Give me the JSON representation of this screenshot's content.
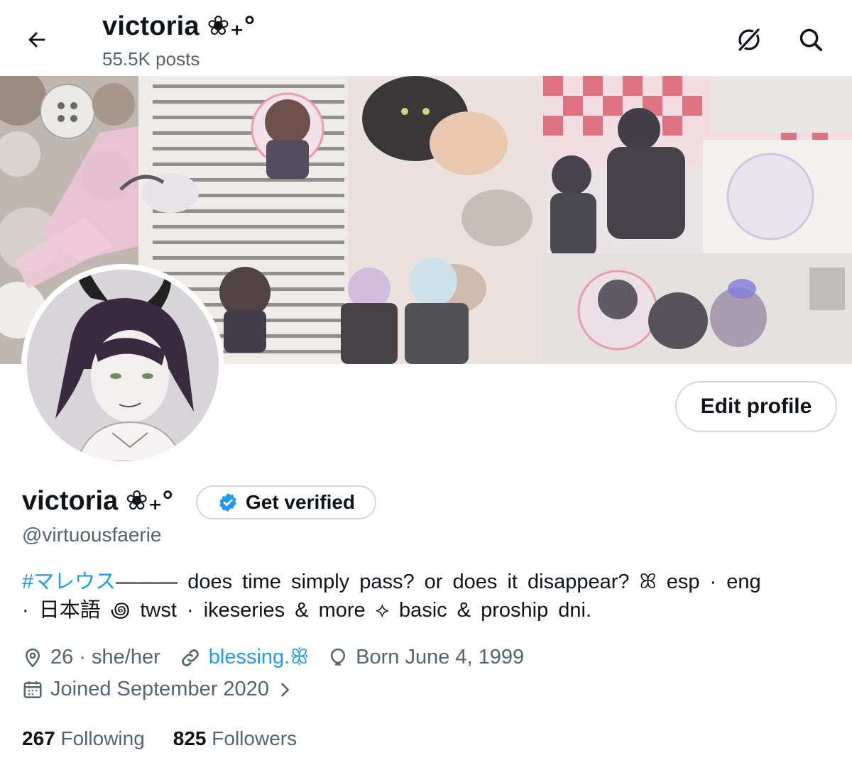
{
  "header": {
    "title": "victoria ❀₊°",
    "posts_count": "55.5K posts"
  },
  "profile": {
    "display_name": "victoria ❀₊°",
    "handle": "@virtuousfaerie",
    "verify_label": "Get verified",
    "edit_label": "Edit profile",
    "bio_hashtag": "#マレウス",
    "bio_line1_rest": "——— does time simply pass? or does it disappear? ꕤ esp · eng",
    "bio_line2": "· 日本語 ꩜ twst · ikeseries & more ⟡ basic & proship dni."
  },
  "meta": {
    "location": "26 · she/her",
    "link": "blessing.ꕥ",
    "birthday": "Born June 4, 1999",
    "joined": "Joined September 2020"
  },
  "stats": {
    "following_count": "267",
    "following_label": "Following",
    "followers_count": "825",
    "followers_label": "Followers"
  },
  "colors": {
    "accent": "#1d9bf0",
    "secondary_text": "#536471",
    "border": "#cfd9de"
  },
  "icons": {
    "back": "arrow-left-icon",
    "grok": "grok-icon",
    "search": "search-icon",
    "verified": "verified-badge-icon",
    "location": "location-pin-icon",
    "link": "link-icon",
    "birthday": "balloon-icon",
    "calendar": "calendar-icon",
    "chevron": "chevron-right-icon"
  }
}
